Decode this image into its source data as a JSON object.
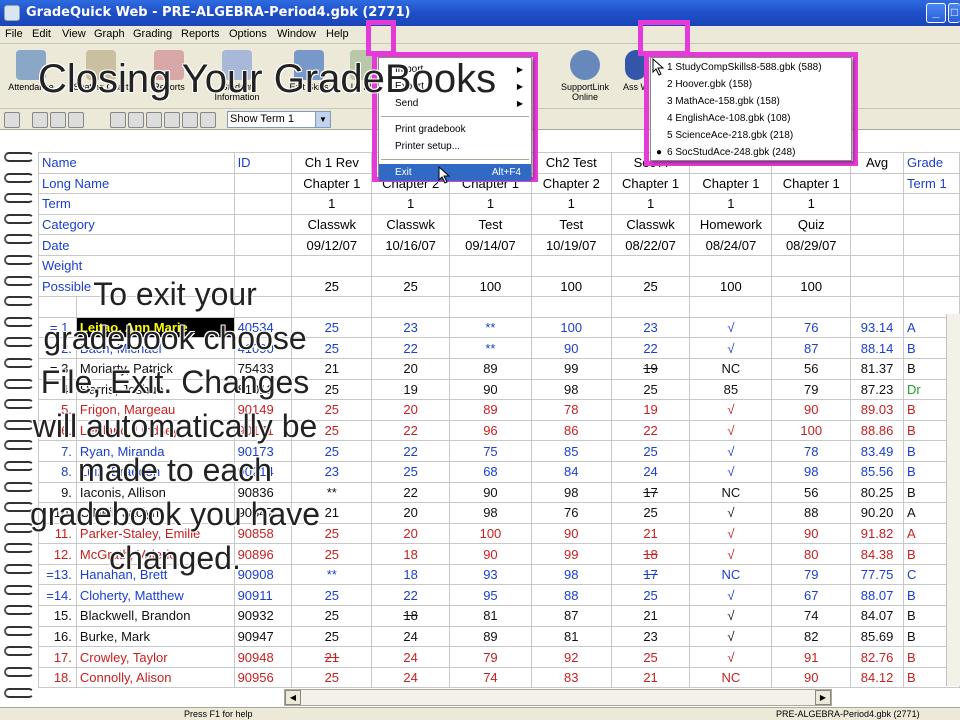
{
  "window": {
    "title": "GradeQuick Web - PRE-ALGEBRA-Period4.gbk (2771)",
    "min_btn": "_",
    "max_btn": "□"
  },
  "menu": [
    "File",
    "Edit",
    "View",
    "Graph",
    "Grading",
    "Reports",
    "Options",
    "Window",
    "Help"
  ],
  "toolbar": {
    "buttons": [
      {
        "label": "Attendance",
        "icon": "attendance-icon"
      },
      {
        "label": "Seating Chart",
        "icon": "seating-chart-icon"
      },
      {
        "label": "Reports",
        "icon": "reports-icon"
      },
      {
        "label": "Student Information",
        "icon": "student-info-icon"
      },
      {
        "label": "Edit Skills",
        "icon": "edit-skills-icon"
      },
      {
        "label": "Le Pl",
        "icon": "lesson-plans-icon"
      },
      {
        "label": "SupportLink Online",
        "icon": "supportlink-icon"
      },
      {
        "label": "Ass W",
        "icon": "assignment-wizard-icon"
      }
    ],
    "term_select": "Show Term 1"
  },
  "file_menu": {
    "items": [
      {
        "label": "Import",
        "submenu": true
      },
      {
        "label": "Export",
        "submenu": true
      },
      {
        "label": "Send",
        "submenu": true
      },
      {
        "label": "Print gradebook",
        "submenu": false
      },
      {
        "label": "Printer setup...",
        "submenu": false
      }
    ],
    "exit": {
      "label": "Exit",
      "accel": "Alt+F4"
    }
  },
  "window_menu": {
    "items": [
      {
        "label": "1 StudyCompSkills8-588.gbk (588)",
        "checked": false
      },
      {
        "label": "2 Hoover.gbk (158)",
        "checked": false
      },
      {
        "label": "3 MathAce-158.gbk (158)",
        "checked": false
      },
      {
        "label": "4 EnglishAce-108.gbk (108)",
        "checked": false
      },
      {
        "label": "5 ScienceAce-218.gbk (218)",
        "checked": false
      },
      {
        "label": "6 SocStudAce-248.gbk (248)",
        "checked": true
      }
    ]
  },
  "grid": {
    "header_rows": [
      [
        "Name",
        "ID",
        "Ch 1 Rev",
        "",
        "",
        "Ch2 Test",
        "Sec A",
        "",
        "",
        "Avg",
        "Grade"
      ],
      [
        "Long Name",
        "",
        "Chapter 1",
        "Chapter 2",
        "Chapter 1",
        "Chapter 2",
        "Chapter 1",
        "Chapter 1",
        "Chapter 1",
        "",
        "Term 1"
      ],
      [
        "Term",
        "",
        "1",
        "1",
        "1",
        "1",
        "1",
        "1",
        "1",
        "",
        ""
      ],
      [
        "Category",
        "",
        "Classwk",
        "Classwk",
        "Test",
        "Test",
        "Classwk",
        "Homework",
        "Quiz",
        "",
        ""
      ],
      [
        "Date",
        "",
        "09/12/07",
        "10/16/07",
        "09/14/07",
        "10/19/07",
        "08/22/07",
        "08/24/07",
        "08/29/07",
        "",
        ""
      ],
      [
        "Weight",
        "",
        "",
        "",
        "",
        "",
        "",
        "",
        "",
        "",
        ""
      ],
      [
        "Possible",
        "",
        "25",
        "25",
        "100",
        "100",
        "25",
        "100",
        "100",
        "",
        ""
      ]
    ],
    "students": [
      {
        "num": "= 1.",
        "name": "Leitao, Ann Marie",
        "id": "40534",
        "scores": [
          "25",
          "23",
          "**",
          "100",
          "23",
          "√",
          "76"
        ],
        "avg": "93.14",
        "grade": "A",
        "color": "blue",
        "selected": true
      },
      {
        "num": "2.",
        "name": "Bach, Michael",
        "id": "41090",
        "scores": [
          "25",
          "22",
          "**",
          "90",
          "22",
          "√",
          "87"
        ],
        "avg": "88.14",
        "grade": "B",
        "color": "blue"
      },
      {
        "num": "= 3.",
        "name": "Moriarty, Patrick",
        "id": "75433",
        "scores": [
          "21",
          "20",
          "89",
          "99",
          "19",
          "NC",
          "56"
        ],
        "avg": "81.37",
        "grade": "B",
        "color": "black",
        "strike": [
          4
        ]
      },
      {
        "num": "4.",
        "name": "Harris, Joshua",
        "id": "81012",
        "scores": [
          "25",
          "19",
          "90",
          "98",
          "25",
          "85",
          "79"
        ],
        "avg": "87.23",
        "grade": "Dr",
        "color": "black",
        "green_grade": true
      },
      {
        "num": "5.",
        "name": "Frigon, Margeau",
        "id": "90149",
        "scores": [
          "25",
          "20",
          "89",
          "78",
          "19",
          "√",
          "90"
        ],
        "avg": "89.03",
        "grade": "B",
        "color": "red"
      },
      {
        "num": "6.",
        "name": "LeBlanc, Lindsey",
        "id": "90171",
        "scores": [
          "25",
          "22",
          "96",
          "86",
          "22",
          "√",
          "100"
        ],
        "avg": "88.86",
        "grade": "B",
        "color": "red"
      },
      {
        "num": "7.",
        "name": "Ryan, Miranda",
        "id": "90173",
        "scores": [
          "25",
          "22",
          "75",
          "85",
          "25",
          "√",
          "78"
        ],
        "avg": "83.49",
        "grade": "B",
        "color": "blue"
      },
      {
        "num": "8.",
        "name": "Luiz, Braedon",
        "id": "90214",
        "scores": [
          "23",
          "25",
          "68",
          "84",
          "24",
          "√",
          "98"
        ],
        "avg": "85.56",
        "grade": "B",
        "color": "blue"
      },
      {
        "num": "9.",
        "name": "Iaconis, Allison",
        "id": "90836",
        "scores": [
          "**",
          "22",
          "90",
          "98",
          "17",
          "NC",
          "56"
        ],
        "avg": "80.25",
        "grade": "B",
        "color": "black",
        "strike": [
          4
        ]
      },
      {
        "num": "10.",
        "name": "O'Neil, Jaclyn",
        "id": "90847",
        "scores": [
          "21",
          "20",
          "98",
          "76",
          "25",
          "√",
          "88"
        ],
        "avg": "90.20",
        "grade": "A",
        "color": "black"
      },
      {
        "num": "11.",
        "name": "Parker-Staley, Emilie",
        "id": "90858",
        "scores": [
          "25",
          "20",
          "100",
          "90",
          "21",
          "√",
          "90"
        ],
        "avg": "91.82",
        "grade": "A",
        "color": "red"
      },
      {
        "num": "12.",
        "name": "McGrath, Valerie",
        "id": "90896",
        "scores": [
          "25",
          "18",
          "90",
          "99",
          "18",
          "√",
          "80"
        ],
        "avg": "84.38",
        "grade": "B",
        "color": "red",
        "strike": [
          4
        ]
      },
      {
        "num": "=13.",
        "name": "Hanahan, Brett",
        "id": "90908",
        "scores": [
          "**",
          "18",
          "93",
          "98",
          "17",
          "NC",
          "79"
        ],
        "avg": "77.75",
        "grade": "C",
        "color": "blue",
        "strike": [
          4
        ]
      },
      {
        "num": "=14.",
        "name": "Cloherty, Matthew",
        "id": "90911",
        "scores": [
          "25",
          "22",
          "95",
          "88",
          "25",
          "√",
          "67"
        ],
        "avg": "88.07",
        "grade": "B",
        "color": "blue"
      },
      {
        "num": "15.",
        "name": "Blackwell, Brandon",
        "id": "90932",
        "scores": [
          "25",
          "18",
          "81",
          "87",
          "21",
          "√",
          "74"
        ],
        "avg": "84.07",
        "grade": "B",
        "color": "black",
        "strike": [
          1
        ]
      },
      {
        "num": "16.",
        "name": "Burke, Mark",
        "id": "90947",
        "scores": [
          "25",
          "24",
          "89",
          "81",
          "23",
          "√",
          "82"
        ],
        "avg": "85.69",
        "grade": "B",
        "color": "black"
      },
      {
        "num": "17.",
        "name": "Crowley, Taylor",
        "id": "90948",
        "scores": [
          "21",
          "24",
          "79",
          "92",
          "25",
          "√",
          "91"
        ],
        "avg": "82.76",
        "grade": "B",
        "color": "red",
        "strike": [
          0
        ]
      },
      {
        "num": "18.",
        "name": "Connolly, Alison",
        "id": "90956",
        "scores": [
          "25",
          "24",
          "74",
          "83",
          "21",
          "NC",
          "90"
        ],
        "avg": "84.12",
        "grade": "B",
        "color": "red"
      }
    ]
  },
  "status": {
    "left": "Press F1 for help",
    "right": "PRE-ALGEBRA-Period4.gbk (2771)"
  },
  "overlay": {
    "title": "Closing Your GradeBooks",
    "body": "To exit your gradebook choose File, Exit. Changes will automatically be made to each gradebook you have changed."
  },
  "colors": {
    "highlight_box": "#e63ad8",
    "title_bar": "#1f4fc8",
    "name_blue": "#1a3fd0",
    "name_red": "#c62020"
  }
}
